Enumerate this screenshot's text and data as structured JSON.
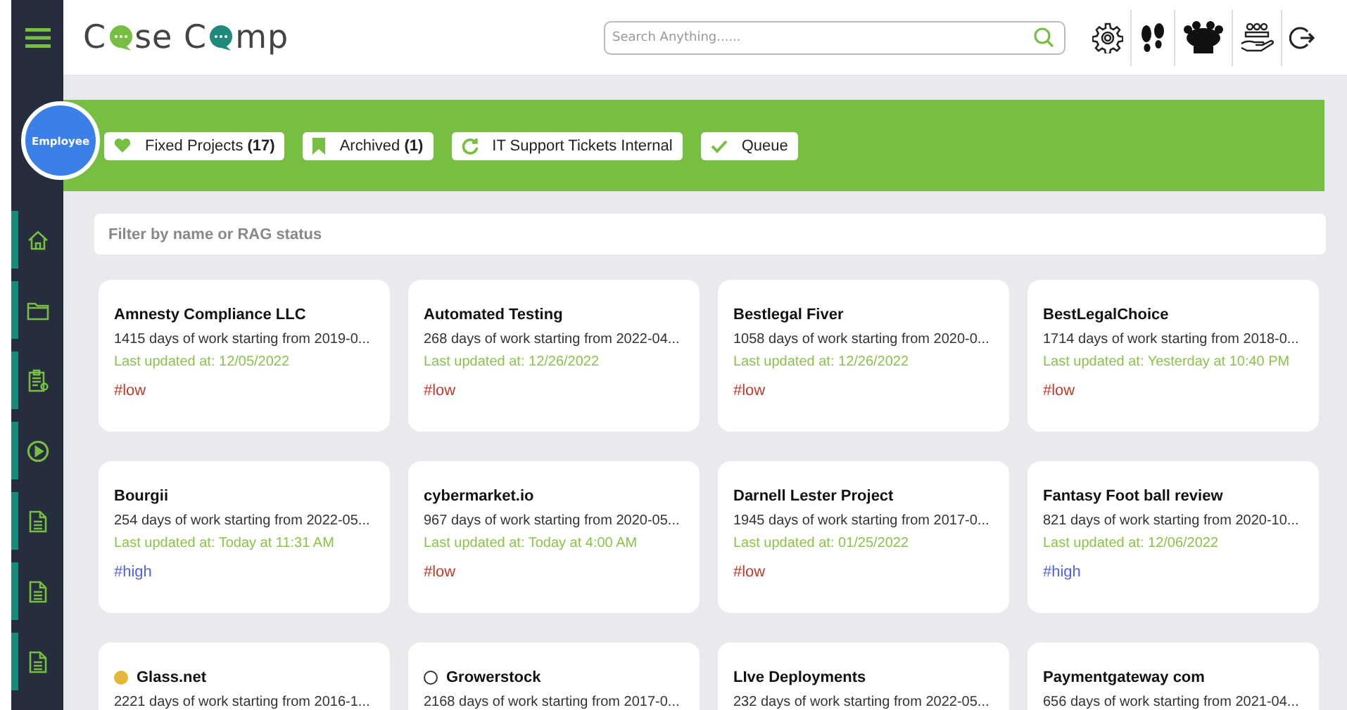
{
  "logo": {
    "parts": [
      "C",
      "se C",
      "mp"
    ]
  },
  "search": {
    "placeholder": "Search Anything......"
  },
  "avatar": {
    "label": "Employee"
  },
  "sidebar": {
    "items": [
      {
        "kind": "home"
      },
      {
        "kind": "folder"
      },
      {
        "kind": "clipboard"
      },
      {
        "kind": "play"
      },
      {
        "kind": "document"
      },
      {
        "kind": "document"
      },
      {
        "kind": "document"
      }
    ]
  },
  "tabs": [
    {
      "kind": "heart",
      "label": "Fixed Projects",
      "count": "(17)"
    },
    {
      "kind": "bookmark",
      "label": "Archived",
      "count": "(1)"
    },
    {
      "kind": "refresh",
      "label": "IT Support Tickets Internal"
    },
    {
      "kind": "check",
      "label": "Queue"
    }
  ],
  "filter": {
    "placeholder": "Filter by name or RAG status"
  },
  "projects": [
    {
      "name": "Amnesty Compliance LLC",
      "description": "1415 days of work starting from 2019-0...",
      "updated": "Last updated at: 12/05/2022",
      "tag": "#low",
      "kind": "low"
    },
    {
      "name": "Automated Testing",
      "description": "268 days of work starting from 2022-04...",
      "updated": "Last updated at: 12/26/2022",
      "tag": "#low",
      "kind": "low"
    },
    {
      "name": "Bestlegal Fiver",
      "description": "1058 days of work starting from 2020-0...",
      "updated": "Last updated at: 12/26/2022",
      "tag": "#low",
      "kind": "low"
    },
    {
      "name": "BestLegalChoice",
      "description": "1714 days of work starting from 2018-0...",
      "updated": "Last updated at: Yesterday at 10:40 PM",
      "tag": "#low",
      "kind": "low"
    },
    {
      "name": "Bourgii",
      "description": "254 days of work starting from 2022-05...",
      "updated": "Last updated at: Today at 11:31 AM",
      "tag": "#high",
      "kind": "high"
    },
    {
      "name": "cybermarket.io",
      "description": "967 days of work starting from 2020-05...",
      "updated": "Last updated at: Today at 4:00 AM",
      "tag": "#low",
      "kind": "low"
    },
    {
      "name": "Darnell Lester Project",
      "description": "1945 days of work starting from 2017-0...",
      "updated": "Last updated at: 01/25/2022",
      "tag": "#low",
      "kind": "low"
    },
    {
      "name": "Fantasy Foot ball review",
      "description": "821 days of work starting from 2020-10...",
      "updated": "Last updated at: 12/06/2022",
      "tag": "#high",
      "kind": "high"
    },
    {
      "name": "Glass.net",
      "description": "2221 days of work starting from 2016-1...",
      "kind": "dot",
      "color": "#e3b53b"
    },
    {
      "name": "Growerstock",
      "description": "2168 days of work starting from 2017-0...",
      "kind": "circle"
    },
    {
      "name": "LIve Deployments",
      "description": "232 days of work starting from 2022-05..."
    },
    {
      "name": "Paymentgateway com",
      "description": "656 days of work starting from 2021-04..."
    }
  ]
}
